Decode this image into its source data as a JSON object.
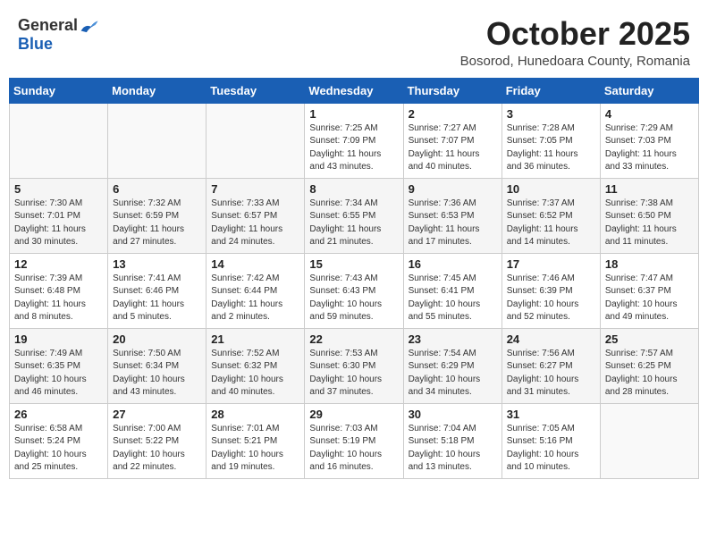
{
  "header": {
    "logo_general": "General",
    "logo_blue": "Blue",
    "month_title": "October 2025",
    "subtitle": "Bosorod, Hunedoara County, Romania"
  },
  "weekdays": [
    "Sunday",
    "Monday",
    "Tuesday",
    "Wednesday",
    "Thursday",
    "Friday",
    "Saturday"
  ],
  "weeks": [
    [
      {
        "day": "",
        "info": ""
      },
      {
        "day": "",
        "info": ""
      },
      {
        "day": "",
        "info": ""
      },
      {
        "day": "1",
        "info": "Sunrise: 7:25 AM\nSunset: 7:09 PM\nDaylight: 11 hours\nand 43 minutes."
      },
      {
        "day": "2",
        "info": "Sunrise: 7:27 AM\nSunset: 7:07 PM\nDaylight: 11 hours\nand 40 minutes."
      },
      {
        "day": "3",
        "info": "Sunrise: 7:28 AM\nSunset: 7:05 PM\nDaylight: 11 hours\nand 36 minutes."
      },
      {
        "day": "4",
        "info": "Sunrise: 7:29 AM\nSunset: 7:03 PM\nDaylight: 11 hours\nand 33 minutes."
      }
    ],
    [
      {
        "day": "5",
        "info": "Sunrise: 7:30 AM\nSunset: 7:01 PM\nDaylight: 11 hours\nand 30 minutes."
      },
      {
        "day": "6",
        "info": "Sunrise: 7:32 AM\nSunset: 6:59 PM\nDaylight: 11 hours\nand 27 minutes."
      },
      {
        "day": "7",
        "info": "Sunrise: 7:33 AM\nSunset: 6:57 PM\nDaylight: 11 hours\nand 24 minutes."
      },
      {
        "day": "8",
        "info": "Sunrise: 7:34 AM\nSunset: 6:55 PM\nDaylight: 11 hours\nand 21 minutes."
      },
      {
        "day": "9",
        "info": "Sunrise: 7:36 AM\nSunset: 6:53 PM\nDaylight: 11 hours\nand 17 minutes."
      },
      {
        "day": "10",
        "info": "Sunrise: 7:37 AM\nSunset: 6:52 PM\nDaylight: 11 hours\nand 14 minutes."
      },
      {
        "day": "11",
        "info": "Sunrise: 7:38 AM\nSunset: 6:50 PM\nDaylight: 11 hours\nand 11 minutes."
      }
    ],
    [
      {
        "day": "12",
        "info": "Sunrise: 7:39 AM\nSunset: 6:48 PM\nDaylight: 11 hours\nand 8 minutes."
      },
      {
        "day": "13",
        "info": "Sunrise: 7:41 AM\nSunset: 6:46 PM\nDaylight: 11 hours\nand 5 minutes."
      },
      {
        "day": "14",
        "info": "Sunrise: 7:42 AM\nSunset: 6:44 PM\nDaylight: 11 hours\nand 2 minutes."
      },
      {
        "day": "15",
        "info": "Sunrise: 7:43 AM\nSunset: 6:43 PM\nDaylight: 10 hours\nand 59 minutes."
      },
      {
        "day": "16",
        "info": "Sunrise: 7:45 AM\nSunset: 6:41 PM\nDaylight: 10 hours\nand 55 minutes."
      },
      {
        "day": "17",
        "info": "Sunrise: 7:46 AM\nSunset: 6:39 PM\nDaylight: 10 hours\nand 52 minutes."
      },
      {
        "day": "18",
        "info": "Sunrise: 7:47 AM\nSunset: 6:37 PM\nDaylight: 10 hours\nand 49 minutes."
      }
    ],
    [
      {
        "day": "19",
        "info": "Sunrise: 7:49 AM\nSunset: 6:35 PM\nDaylight: 10 hours\nand 46 minutes."
      },
      {
        "day": "20",
        "info": "Sunrise: 7:50 AM\nSunset: 6:34 PM\nDaylight: 10 hours\nand 43 minutes."
      },
      {
        "day": "21",
        "info": "Sunrise: 7:52 AM\nSunset: 6:32 PM\nDaylight: 10 hours\nand 40 minutes."
      },
      {
        "day": "22",
        "info": "Sunrise: 7:53 AM\nSunset: 6:30 PM\nDaylight: 10 hours\nand 37 minutes."
      },
      {
        "day": "23",
        "info": "Sunrise: 7:54 AM\nSunset: 6:29 PM\nDaylight: 10 hours\nand 34 minutes."
      },
      {
        "day": "24",
        "info": "Sunrise: 7:56 AM\nSunset: 6:27 PM\nDaylight: 10 hours\nand 31 minutes."
      },
      {
        "day": "25",
        "info": "Sunrise: 7:57 AM\nSunset: 6:25 PM\nDaylight: 10 hours\nand 28 minutes."
      }
    ],
    [
      {
        "day": "26",
        "info": "Sunrise: 6:58 AM\nSunset: 5:24 PM\nDaylight: 10 hours\nand 25 minutes."
      },
      {
        "day": "27",
        "info": "Sunrise: 7:00 AM\nSunset: 5:22 PM\nDaylight: 10 hours\nand 22 minutes."
      },
      {
        "day": "28",
        "info": "Sunrise: 7:01 AM\nSunset: 5:21 PM\nDaylight: 10 hours\nand 19 minutes."
      },
      {
        "day": "29",
        "info": "Sunrise: 7:03 AM\nSunset: 5:19 PM\nDaylight: 10 hours\nand 16 minutes."
      },
      {
        "day": "30",
        "info": "Sunrise: 7:04 AM\nSunset: 5:18 PM\nDaylight: 10 hours\nand 13 minutes."
      },
      {
        "day": "31",
        "info": "Sunrise: 7:05 AM\nSunset: 5:16 PM\nDaylight: 10 hours\nand 10 minutes."
      },
      {
        "day": "",
        "info": ""
      }
    ]
  ]
}
